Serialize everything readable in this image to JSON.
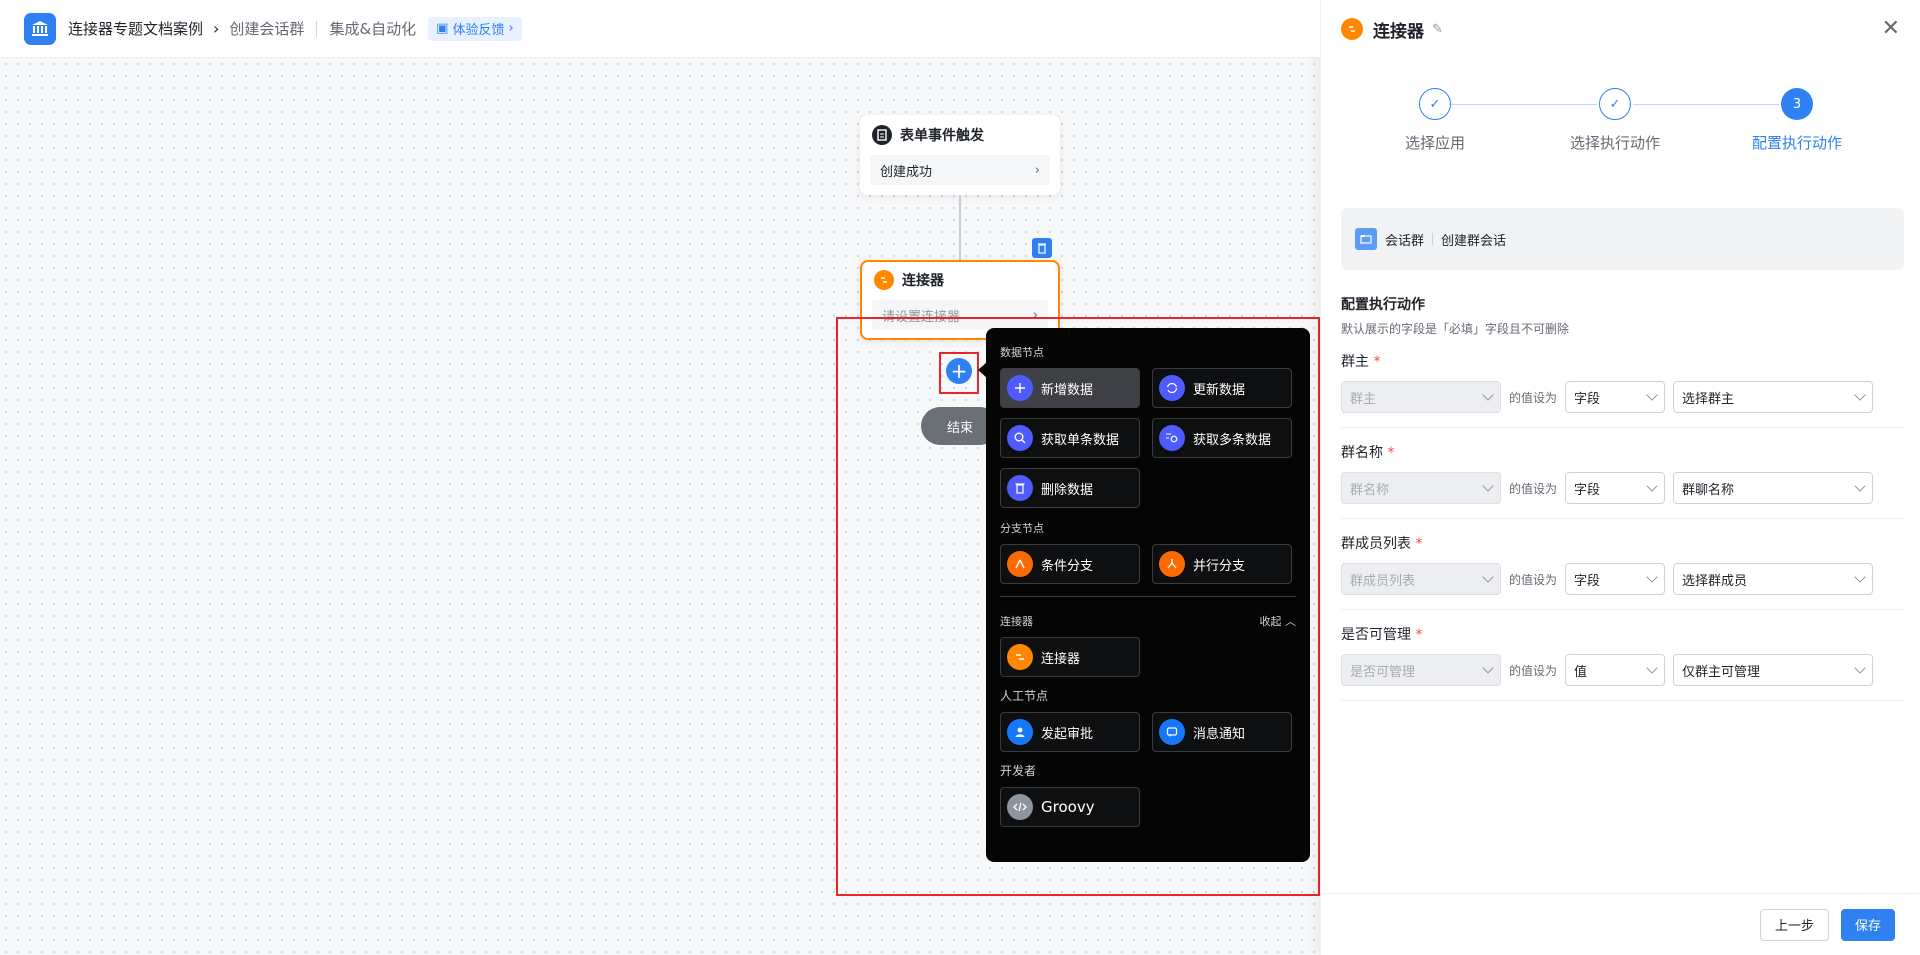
{
  "header": {
    "app_name": "连接器专题文档案例",
    "page": "创建会话群",
    "section": "集成&自动化",
    "feedback": "体验反馈"
  },
  "flow": {
    "trigger": {
      "title": "表单事件触发",
      "value": "创建成功"
    },
    "connector": {
      "title": "连接器",
      "value": "请设置连接器"
    },
    "end": "结束"
  },
  "menu": {
    "data_section": "数据节点",
    "data_items": [
      "新增数据",
      "更新数据",
      "获取单条数据",
      "获取多条数据",
      "删除数据"
    ],
    "branch_section": "分支节点",
    "branch_items": [
      "条件分支",
      "并行分支"
    ],
    "connector_section": "连接器",
    "collapse": "收起",
    "connector_item": "连接器",
    "manual_section": "人工节点",
    "manual_items": [
      "发起审批",
      "消息通知"
    ],
    "dev_section": "开发者",
    "dev_item": "Groovy"
  },
  "panel": {
    "title": "连接器",
    "steps": [
      "选择应用",
      "选择执行动作",
      "配置执行动作"
    ],
    "current_step_number": "3",
    "app": {
      "name": "会话群",
      "action": "创建群会话"
    },
    "config_title": "配置执行动作",
    "config_desc": "默认展示的字段是「必填」字段且不可删除",
    "value_word": "的值设为",
    "fields": [
      {
        "label": "群主",
        "target": "群主",
        "mode": "字段",
        "value": "选择群主"
      },
      {
        "label": "群名称",
        "target": "群名称",
        "mode": "字段",
        "value": "群聊名称"
      },
      {
        "label": "群成员列表",
        "target": "群成员列表",
        "mode": "字段",
        "value": "选择群成员"
      },
      {
        "label": "是否可管理",
        "target": "是否可管理",
        "mode": "值",
        "value": "仅群主可管理"
      }
    ],
    "prev": "上一步",
    "save": "保存"
  },
  "colors": {
    "accent": "#2f80f0",
    "danger": "#e8262a",
    "orange": "#ff8800"
  }
}
